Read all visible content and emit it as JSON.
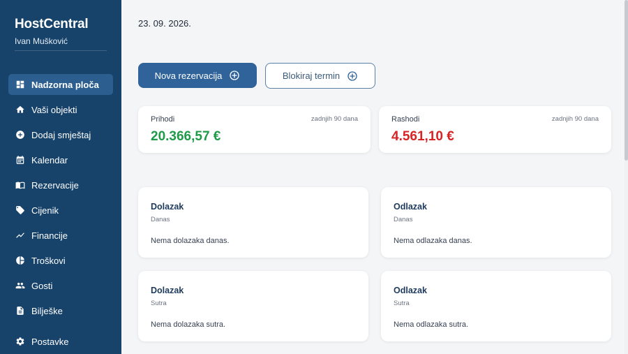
{
  "app": {
    "name": "HostCentral",
    "user": "Ivan Mušković"
  },
  "sidebar": {
    "items": [
      {
        "label": "Nadzorna ploča",
        "icon": "dashboard-icon",
        "active": true
      },
      {
        "label": "Vaši objekti",
        "icon": "home-icon"
      },
      {
        "label": "Dodaj smještaj",
        "icon": "add-circle-icon"
      },
      {
        "label": "Kalendar",
        "icon": "calendar-icon"
      },
      {
        "label": "Rezervacije",
        "icon": "book-icon"
      },
      {
        "label": "Cijenik",
        "icon": "tag-icon"
      },
      {
        "label": "Financije",
        "icon": "trending-icon"
      },
      {
        "label": "Troškovi",
        "icon": "pie-chart-icon"
      },
      {
        "label": "Gosti",
        "icon": "people-icon"
      },
      {
        "label": "Bilješke",
        "icon": "note-icon"
      }
    ],
    "settings": {
      "label": "Postavke",
      "icon": "gear-icon"
    }
  },
  "header": {
    "date": "23. 09. 2026."
  },
  "actions": {
    "new_reservation": "Nova rezervacija",
    "block_term": "Blokiraj termin"
  },
  "stats": {
    "income": {
      "label": "Prihodi",
      "period": "zadnjih 90 dana",
      "value": "20.366,57 €"
    },
    "expenses": {
      "label": "Rashodi",
      "period": "zadnjih 90 dana",
      "value": "4.561,10 €"
    }
  },
  "events": {
    "arrival_today": {
      "title": "Dolazak",
      "when": "Danas",
      "empty": "Nema dolazaka danas."
    },
    "departure_today": {
      "title": "Odlazak",
      "when": "Danas",
      "empty": "Nema odlazaka danas."
    },
    "arrival_tomorrow": {
      "title": "Dolazak",
      "when": "Sutra",
      "empty": "Nema dolazaka sutra."
    },
    "departure_tomorrow": {
      "title": "Odlazak",
      "when": "Sutra",
      "empty": "Nema odlazaka sutra."
    }
  },
  "colors": {
    "sidebar": "#17436b",
    "primary": "#2f6399",
    "income": "#1e9a48",
    "expense": "#d62424"
  }
}
